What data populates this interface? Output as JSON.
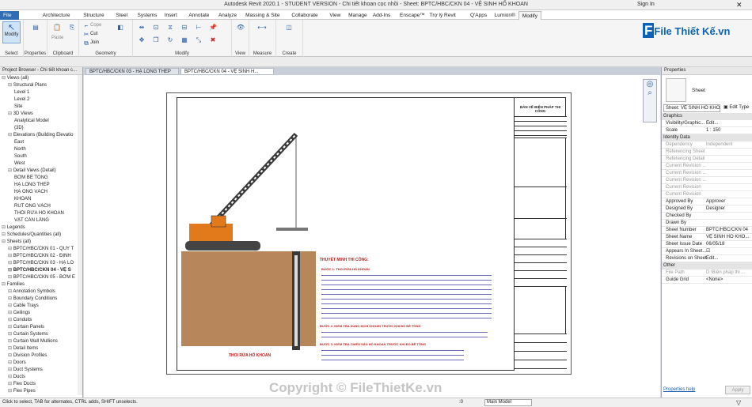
{
  "titlebar": {
    "title": "Autodesk Revit 2020.1 - STUDENT VERSION - Chi tiết khoan cọc nhồi - Sheet: BPTC/HBC/CKN 04 - VỆ SINH HỐ KHOAN",
    "sign_in": "Sign In"
  },
  "ribbon_tabs": [
    "File",
    "Architecture",
    "Structure",
    "Steel",
    "Systems",
    "Insert",
    "Annotate",
    "Analyze",
    "Massing & Site",
    "Collaborate",
    "View",
    "Manage",
    "Add-Ins",
    "Enscape™",
    "Trợ lý Revit",
    "Q'Apps",
    "Lumion®",
    "Modify"
  ],
  "ribbon": {
    "modify": "Modify",
    "select": "Select",
    "properties": "Properties",
    "clipboard": "Clipboard",
    "paste": "Paste",
    "cope": "Cope",
    "cut": "Cut",
    "join": "Join",
    "geometry": "Geometry",
    "modify_panel": "Modify",
    "view": "View",
    "measure": "Measure",
    "create": "Create"
  },
  "doc_tabs": [
    "BPTC/HBC/CKN 03 - HẠ LỒNG THÉP",
    "BPTC/HBC/CKN 04 - VỆ SINH H..."
  ],
  "project_browser": {
    "title": "Project Browser - Chi tiết khoan c...",
    "items": [
      {
        "t": "Views (all)",
        "d": 0
      },
      {
        "t": "Structural Plans",
        "d": 1
      },
      {
        "t": "Level 1",
        "d": 2
      },
      {
        "t": "Level 2",
        "d": 2
      },
      {
        "t": "Site",
        "d": 2
      },
      {
        "t": "3D Views",
        "d": 1
      },
      {
        "t": "Analytical Model",
        "d": 2
      },
      {
        "t": "{3D}",
        "d": 2
      },
      {
        "t": "Elevations (Building Elevatio",
        "d": 1
      },
      {
        "t": "East",
        "d": 2
      },
      {
        "t": "North",
        "d": 2
      },
      {
        "t": "South",
        "d": 2
      },
      {
        "t": "West",
        "d": 2
      },
      {
        "t": "Detail Views (Detail)",
        "d": 1
      },
      {
        "t": "BƠM BÊ TÔNG",
        "d": 2
      },
      {
        "t": "HẠ LỒNG THÉP",
        "d": 2
      },
      {
        "t": "HẠ ỐNG VÁCH",
        "d": 2
      },
      {
        "t": "KHOAN",
        "d": 2
      },
      {
        "t": "RÚT ỐNG VÁCH",
        "d": 2
      },
      {
        "t": "THỔI RỬA HỐ KHOAN",
        "d": 2
      },
      {
        "t": "VẬT CẢN LẮNG",
        "d": 2
      },
      {
        "t": "Legends",
        "d": 0
      },
      {
        "t": "Schedules/Quantities (all)",
        "d": 0
      },
      {
        "t": "Sheets (all)",
        "d": 0
      },
      {
        "t": "BPTC/HBC/CKN 01 - QUY T",
        "d": 1
      },
      {
        "t": "BPTC/HBC/CKN 02 - ĐỊNH",
        "d": 1
      },
      {
        "t": "BPTC/HBC/CKN 03 - HẠ LỒ",
        "d": 1
      },
      {
        "t": "BPTC/HBC/CKN 04 - VỆ S",
        "d": 1,
        "b": true
      },
      {
        "t": "BPTC/HBC/CKN 05 - BƠM E",
        "d": 1
      },
      {
        "t": "Families",
        "d": 0
      },
      {
        "t": "Annotation Symbols",
        "d": 1
      },
      {
        "t": "Boundary Conditions",
        "d": 1
      },
      {
        "t": "Cable Trays",
        "d": 1
      },
      {
        "t": "Ceilings",
        "d": 1
      },
      {
        "t": "Conduits",
        "d": 1
      },
      {
        "t": "Curtain Panels",
        "d": 1
      },
      {
        "t": "Curtain Systems",
        "d": 1
      },
      {
        "t": "Curtain Wall Mullions",
        "d": 1
      },
      {
        "t": "Detail Items",
        "d": 1
      },
      {
        "t": "Division Profiles",
        "d": 1
      },
      {
        "t": "Doors",
        "d": 1
      },
      {
        "t": "Duct Systems",
        "d": 1
      },
      {
        "t": "Ducts",
        "d": 1
      },
      {
        "t": "Flex Ducts",
        "d": 1
      },
      {
        "t": "Flex Pipes",
        "d": 1
      }
    ]
  },
  "sheet": {
    "title_block": "BẢN VẼ BIỆN PHÁP THI CÔNG",
    "heading": "THUYẾT MINH THI CÔNG:",
    "step1": "BƯỚC 1: THỔI RỬA HỐ KHOAN",
    "step2": "BƯỚC 2: KIỂM TRA DUNG DỊCH KHOAN TRƯỚC KHI ĐỔ BÊ TÔNG",
    "step3": "BƯỚC 3: KIỂM TRA CHIỀU SÂU HỐ KHOAN TRƯỚC KHI ĐỔ BÊ TÔNG",
    "caption": "THỔI RỬA HỐ KHOAN"
  },
  "properties": {
    "title": "Properties",
    "type": "Sheet",
    "selector": "Sheet: VỆ SINH HỐ KHO",
    "edit_type": "Edit Type",
    "rows": [
      {
        "s": "Graphics"
      },
      {
        "k": "Visibility/Graphic...",
        "v": "Edit..."
      },
      {
        "k": "Scale",
        "v": "1 : 150"
      },
      {
        "s": "Identity Data"
      },
      {
        "k": "Dependency",
        "v": "Independent",
        "g": true
      },
      {
        "k": "Referencing Sheet",
        "v": "",
        "g": true
      },
      {
        "k": "Referencing Detail",
        "v": "",
        "g": true
      },
      {
        "k": "Current Revision ...",
        "v": "",
        "g": true
      },
      {
        "k": "Current Revision ...",
        "v": "",
        "g": true
      },
      {
        "k": "Current Revision ...",
        "v": "",
        "g": true
      },
      {
        "k": "Current Revision",
        "v": "",
        "g": true
      },
      {
        "k": "Current Revision",
        "v": "",
        "g": true
      },
      {
        "k": "Approved By",
        "v": "Approver"
      },
      {
        "k": "Designed By",
        "v": "Designer"
      },
      {
        "k": "Checked By",
        "v": ""
      },
      {
        "k": "Drawn By",
        "v": ""
      },
      {
        "k": "Sheet Number",
        "v": "BPTC/HBC/CKN 04"
      },
      {
        "k": "Sheet Name",
        "v": "VỆ SINH HỐ KHO..."
      },
      {
        "k": "Sheet Issue Date",
        "v": "06/05/18"
      },
      {
        "k": "Appears In Sheet...",
        "v": "☑"
      },
      {
        "k": "Revisions on Sheet",
        "v": "Edit..."
      },
      {
        "s": "Other"
      },
      {
        "k": "File Path",
        "v": "D:\\Biện pháp thi ...",
        "g": true
      },
      {
        "k": "Guide Grid",
        "v": "<None>"
      }
    ],
    "help": "Properties help",
    "apply": "Apply"
  },
  "status": {
    "text": "Click to select, TAB for alternates, CTRL adds, SHIFT unselects.",
    "model": "Main Model",
    "zoom": ":0"
  },
  "watermark": "Copyright © FileThietKe.vn",
  "logo": "File Thiết Kế.vn"
}
